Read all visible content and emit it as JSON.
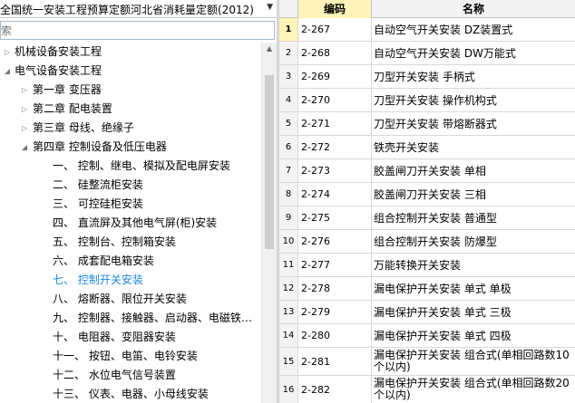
{
  "quota_selector": {
    "value": "全国统一安装工程预算定额河北省消耗量定额(2012)",
    "arrow_icon": "dropdown-arrow-icon"
  },
  "search": {
    "placeholder": "搜索"
  },
  "tree": [
    {
      "label": "机械设备安装工程",
      "level": 0,
      "state": "collapsed"
    },
    {
      "label": "电气设备安装工程",
      "level": 0,
      "state": "expanded"
    },
    {
      "label": "第一章  变压器",
      "level": 1,
      "state": "collapsed"
    },
    {
      "label": "第二章  配电装置",
      "level": 1,
      "state": "collapsed"
    },
    {
      "label": "第三章  母线、绝缘子",
      "level": 1,
      "state": "collapsed"
    },
    {
      "label": "第四章  控制设备及低压电器",
      "level": 1,
      "state": "expanded"
    },
    {
      "label": "一、  控制、继电、模拟及配电屏安装",
      "level": 2,
      "state": "leaf"
    },
    {
      "label": "二、  硅整流柜安装",
      "level": 2,
      "state": "leaf"
    },
    {
      "label": "三、  可控硅柜安装",
      "level": 2,
      "state": "leaf"
    },
    {
      "label": "四、  直流屏及其他电气屏(柜)安装",
      "level": 2,
      "state": "leaf"
    },
    {
      "label": "五、  控制台、控制箱安装",
      "level": 2,
      "state": "leaf"
    },
    {
      "label": "六、  成套配电箱安装",
      "level": 2,
      "state": "leaf"
    },
    {
      "label": "七、  控制开关安装",
      "level": 2,
      "state": "leaf",
      "active": true
    },
    {
      "label": "八、  熔断器、限位开关安装",
      "level": 2,
      "state": "leaf"
    },
    {
      "label": "九、  控制器、接触器、启动器、电磁铁…",
      "level": 2,
      "state": "leaf"
    },
    {
      "label": "十、  电阻器、变阻器安装",
      "level": 2,
      "state": "leaf"
    },
    {
      "label": "十一、  按钮、电笛、电铃安装",
      "level": 2,
      "state": "leaf"
    },
    {
      "label": "十二、  水位电气信号装置",
      "level": 2,
      "state": "leaf"
    },
    {
      "label": "十三、  仪表、电器、小母线安装",
      "level": 2,
      "state": "leaf"
    }
  ],
  "grid": {
    "headers": {
      "num": "",
      "code": "编码",
      "name": "名称"
    },
    "rows": [
      {
        "num": "1",
        "code": "2-267",
        "name": "自动空气开关安装 DZ装置式",
        "selected": true
      },
      {
        "num": "2",
        "code": "2-268",
        "name": "自动空气开关安装 DW万能式"
      },
      {
        "num": "3",
        "code": "2-269",
        "name": "刀型开关安装 手柄式"
      },
      {
        "num": "4",
        "code": "2-270",
        "name": "刀型开关安装 操作机构式"
      },
      {
        "num": "5",
        "code": "2-271",
        "name": "刀型开关安装 带熔断器式"
      },
      {
        "num": "6",
        "code": "2-272",
        "name": "铁壳开关安装"
      },
      {
        "num": "7",
        "code": "2-273",
        "name": "胶盖闸刀开关安装 单相"
      },
      {
        "num": "8",
        "code": "2-274",
        "name": "胶盖闸刀开关安装 三相"
      },
      {
        "num": "9",
        "code": "2-275",
        "name": "组合控制开关安装 普通型"
      },
      {
        "num": "10",
        "code": "2-276",
        "name": "组合控制开关安装 防爆型"
      },
      {
        "num": "11",
        "code": "2-277",
        "name": "万能转换开关安装"
      },
      {
        "num": "12",
        "code": "2-278",
        "name": "漏电保护开关安装 单式 单极"
      },
      {
        "num": "13",
        "code": "2-279",
        "name": "漏电保护开关安装 单式 三极"
      },
      {
        "num": "14",
        "code": "2-280",
        "name": "漏电保护开关安装 单式 四极"
      },
      {
        "num": "15",
        "code": "2-281",
        "name": "漏电保护开关安装 组合式(单相回路数10个以内)",
        "wrap": true
      },
      {
        "num": "16",
        "code": "2-282",
        "name": "漏电保护开关安装 组合式(单相回路数20个以内)",
        "wrap": true
      }
    ]
  }
}
